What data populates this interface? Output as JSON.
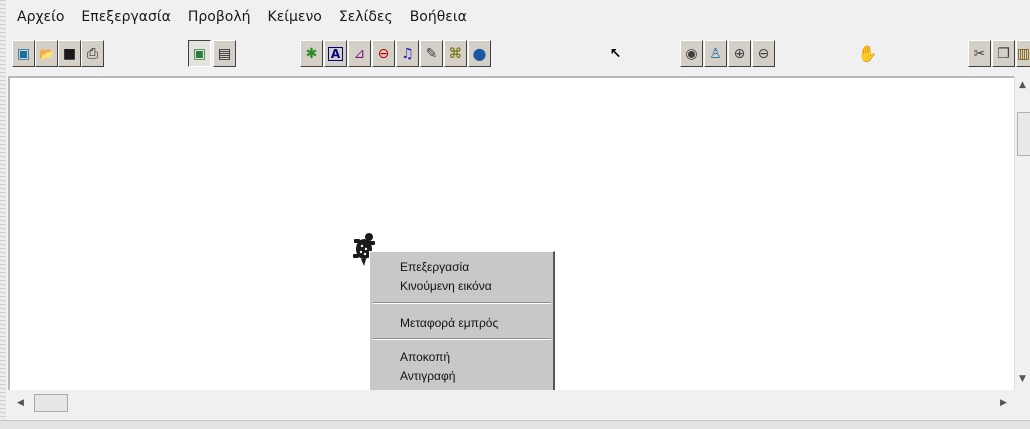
{
  "menubar": {
    "items": [
      {
        "label": "Αρχείο"
      },
      {
        "label": "Επεξεργασία"
      },
      {
        "label": "Προβολή"
      },
      {
        "label": "Κείμενο"
      },
      {
        "label": "Σελίδες"
      },
      {
        "label": "Βοήθεια"
      }
    ]
  },
  "toolbar": {
    "buttons": [
      {
        "name": "new-page-icon",
        "glyph": "▣",
        "color": "#1a6e9e"
      },
      {
        "name": "open-folder-icon",
        "glyph": "📂",
        "color": "#b08a00"
      },
      {
        "name": "save-disk-icon",
        "glyph": "■",
        "color": "#1a1a1a"
      },
      {
        "name": "print-icon",
        "glyph": "⎙",
        "color": "#1a1a1a"
      },
      {
        "name": "page-view-icon",
        "glyph": "▣",
        "color": "#2a7f3f"
      },
      {
        "name": "notebook-icon",
        "glyph": "▤",
        "color": "#1a1a1a"
      },
      {
        "name": "turtle-icon",
        "glyph": "✱",
        "color": "#2a8a2a"
      },
      {
        "name": "text-box-icon",
        "glyph": "A",
        "color": "#000080"
      },
      {
        "name": "paint-brush-icon",
        "glyph": "⊿",
        "color": "#7a1a7a"
      },
      {
        "name": "button-widget-icon",
        "glyph": "⊖",
        "color": "#c00000"
      },
      {
        "name": "music-note-icon",
        "glyph": "♫",
        "color": "#2020c0"
      },
      {
        "name": "microphone-icon",
        "glyph": "✎",
        "color": "#404040"
      },
      {
        "name": "video-camera-icon",
        "glyph": "⌘",
        "color": "#6a6a00"
      },
      {
        "name": "globe-icon",
        "glyph": "●",
        "color": "#1a5aa0"
      },
      {
        "name": "pointer-arrow-icon",
        "glyph": "↖",
        "color": "#000000"
      },
      {
        "name": "eye-icon",
        "glyph": "◉",
        "color": "#404040"
      },
      {
        "name": "stamp-icon",
        "glyph": "♙",
        "color": "#1a6e9e"
      },
      {
        "name": "zoom-in-icon",
        "glyph": "⊕",
        "color": "#404040"
      },
      {
        "name": "zoom-out-icon",
        "glyph": "⊖",
        "color": "#404040"
      },
      {
        "name": "stop-hand-icon",
        "glyph": "✋",
        "color": "#c00000"
      },
      {
        "name": "cut-scissors-icon",
        "glyph": "✂",
        "color": "#404040"
      },
      {
        "name": "copy-icon",
        "glyph": "❐",
        "color": "#404040"
      },
      {
        "name": "paste-icon",
        "glyph": "▥",
        "color": "#7a5a00"
      }
    ]
  },
  "context_menu": {
    "group1": [
      "Επεξεργασία",
      "Κινούμενη εικόνα"
    ],
    "group2": [
      "Μεταφορά εμπρός"
    ],
    "group3": [
      "Αποκοπή",
      "Αντιγραφή"
    ]
  },
  "colors": {
    "workspace_bg": "#ffffff",
    "menu_bg": "#c8c8c8",
    "toolbar_face": "#d4d0c8"
  }
}
